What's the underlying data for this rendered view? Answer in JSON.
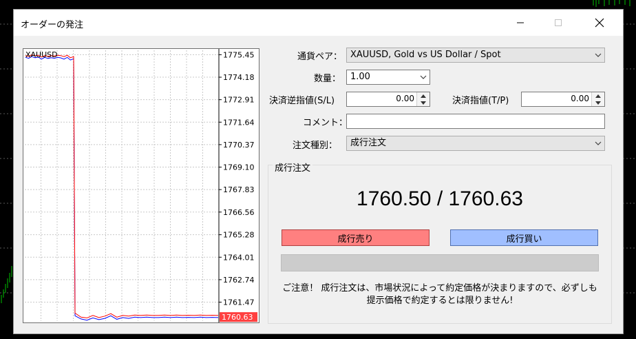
{
  "dialog": {
    "title": "オーダーの発注"
  },
  "form": {
    "symbol_label": "通貨ペア：",
    "symbol_value": "XAUUSD, Gold vs US Dollar / Spot",
    "volume_label": "数量：",
    "volume_value": "1.00",
    "sl_label": "決済逆指値(S/L)",
    "sl_value": "0.00",
    "tp_label": "決済指値(T/P)",
    "tp_value": "0.00",
    "comment_label": "コメント：",
    "comment_value": "",
    "type_label": "注文種別：",
    "type_value": "成行注文"
  },
  "execution": {
    "group_title": "成行注文",
    "bid": "1760.50",
    "ask": "1760.63",
    "price_separator": " / ",
    "sell_label": "成行売り",
    "buy_label": "成行買い",
    "notice_line1": "ご注意！ 成行注文は、市場状況によって約定価格が決まりますので、必ずしも",
    "notice_line2": "提示価格で約定するとは限りません!"
  },
  "chart_data": {
    "type": "line",
    "title": "XAUUSD",
    "y_ticks": [
      1775.45,
      1774.18,
      1772.91,
      1771.64,
      1770.37,
      1769.1,
      1767.83,
      1766.56,
      1765.28,
      1764.01,
      1762.74,
      1761.47
    ],
    "ylim": [
      1760.4,
      1775.7
    ],
    "current_price_label": "1760.63",
    "current_price": 1760.63,
    "series": [
      {
        "color": "#0000ff",
        "values": [
          1775.3,
          1775.25,
          1775.35,
          1775.28,
          1775.32,
          1775.2,
          1775.3,
          1775.24,
          1775.28,
          1775.25,
          1775.3,
          1775.27,
          1775.2,
          1775.3,
          1775.15,
          1775.22,
          1760.7,
          1760.52,
          1760.45,
          1760.58,
          1760.48,
          1760.55,
          1760.7,
          1760.5,
          1760.6,
          1760.55,
          1760.62,
          1760.6,
          1760.62,
          1760.6,
          1760.6,
          1760.62,
          1760.6,
          1760.62,
          1760.6,
          1760.61,
          1760.6,
          1760.62,
          1760.6,
          1760.61,
          1760.6
        ]
      },
      {
        "color": "#ff0000",
        "values": [
          1775.4,
          1775.36,
          1775.44,
          1775.4,
          1775.42,
          1775.32,
          1775.4,
          1775.36,
          1775.4,
          1775.38,
          1775.42,
          1775.4,
          1775.34,
          1775.42,
          1775.28,
          1775.34,
          1760.85,
          1760.62,
          1760.58,
          1760.72,
          1760.6,
          1760.68,
          1760.82,
          1760.62,
          1760.72,
          1760.68,
          1760.74,
          1760.72,
          1760.74,
          1760.72,
          1760.72,
          1760.74,
          1760.72,
          1760.74,
          1760.72,
          1760.73,
          1760.72,
          1760.74,
          1760.72,
          1760.73,
          1760.72
        ]
      }
    ]
  }
}
